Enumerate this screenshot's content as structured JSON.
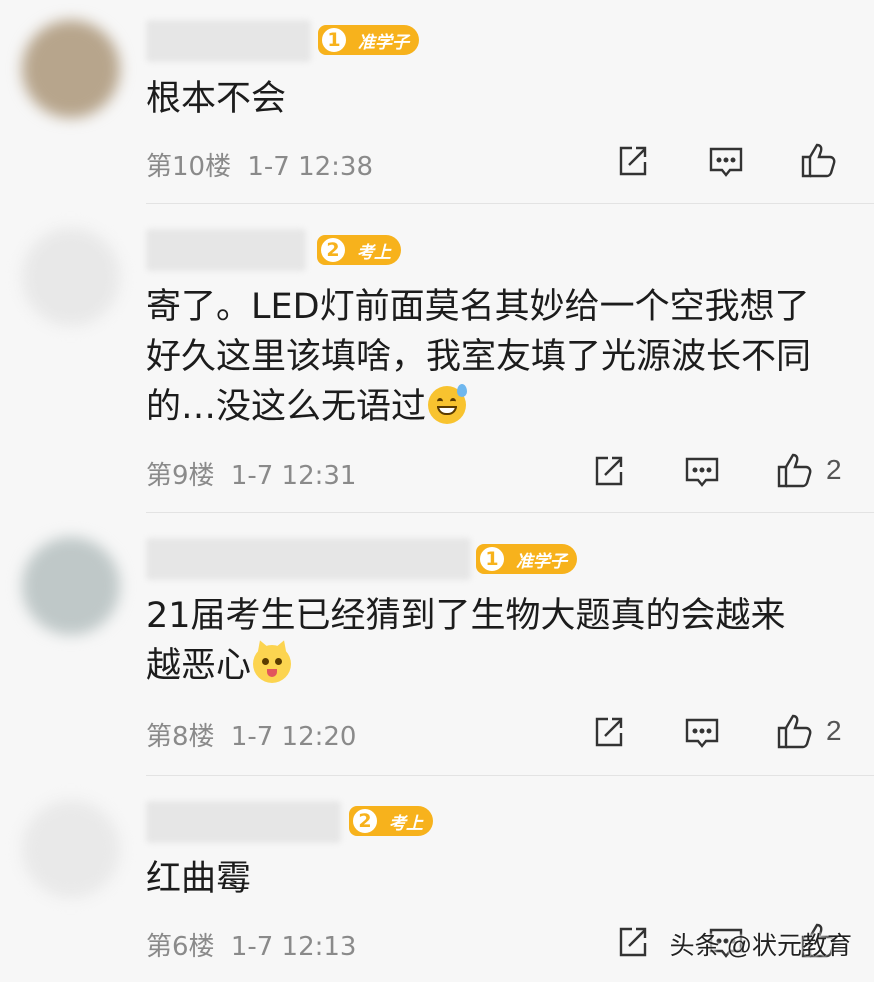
{
  "comments": [
    {
      "badge_level": "1",
      "badge_text": "准学子",
      "text_lines": [
        "根本不会"
      ],
      "floor": "第10楼",
      "time": "1-7 12:38",
      "likes": ""
    },
    {
      "badge_level": "2",
      "badge_text": "考上",
      "text_lines": [
        "寄了。LED灯前面莫名其妙给一个空我想了",
        "好久这里该填啥，我室友填了光源波长不同",
        "的…没这么无语过"
      ],
      "floor": "第9楼",
      "time": "1-7 12:31",
      "likes": "2"
    },
    {
      "badge_level": "1",
      "badge_text": "准学子",
      "text_lines": [
        "21届考生已经猜到了生物大题真的会越来",
        "越恶心"
      ],
      "floor": "第8楼",
      "time": "1-7 12:20",
      "likes": "2"
    },
    {
      "badge_level": "2",
      "badge_text": "考上",
      "text_lines": [
        "红曲霉"
      ],
      "floor": "第6楼",
      "time": "1-7 12:13",
      "likes": ""
    }
  ],
  "icons": {
    "share": "share-icon",
    "comment": "comment-icon",
    "like": "like-icon"
  },
  "colors": {
    "badge": "#f7b21c",
    "background": "#f7f7f7",
    "meta_text": "#8a8a8a"
  },
  "watermark": "头条 @状元教育"
}
